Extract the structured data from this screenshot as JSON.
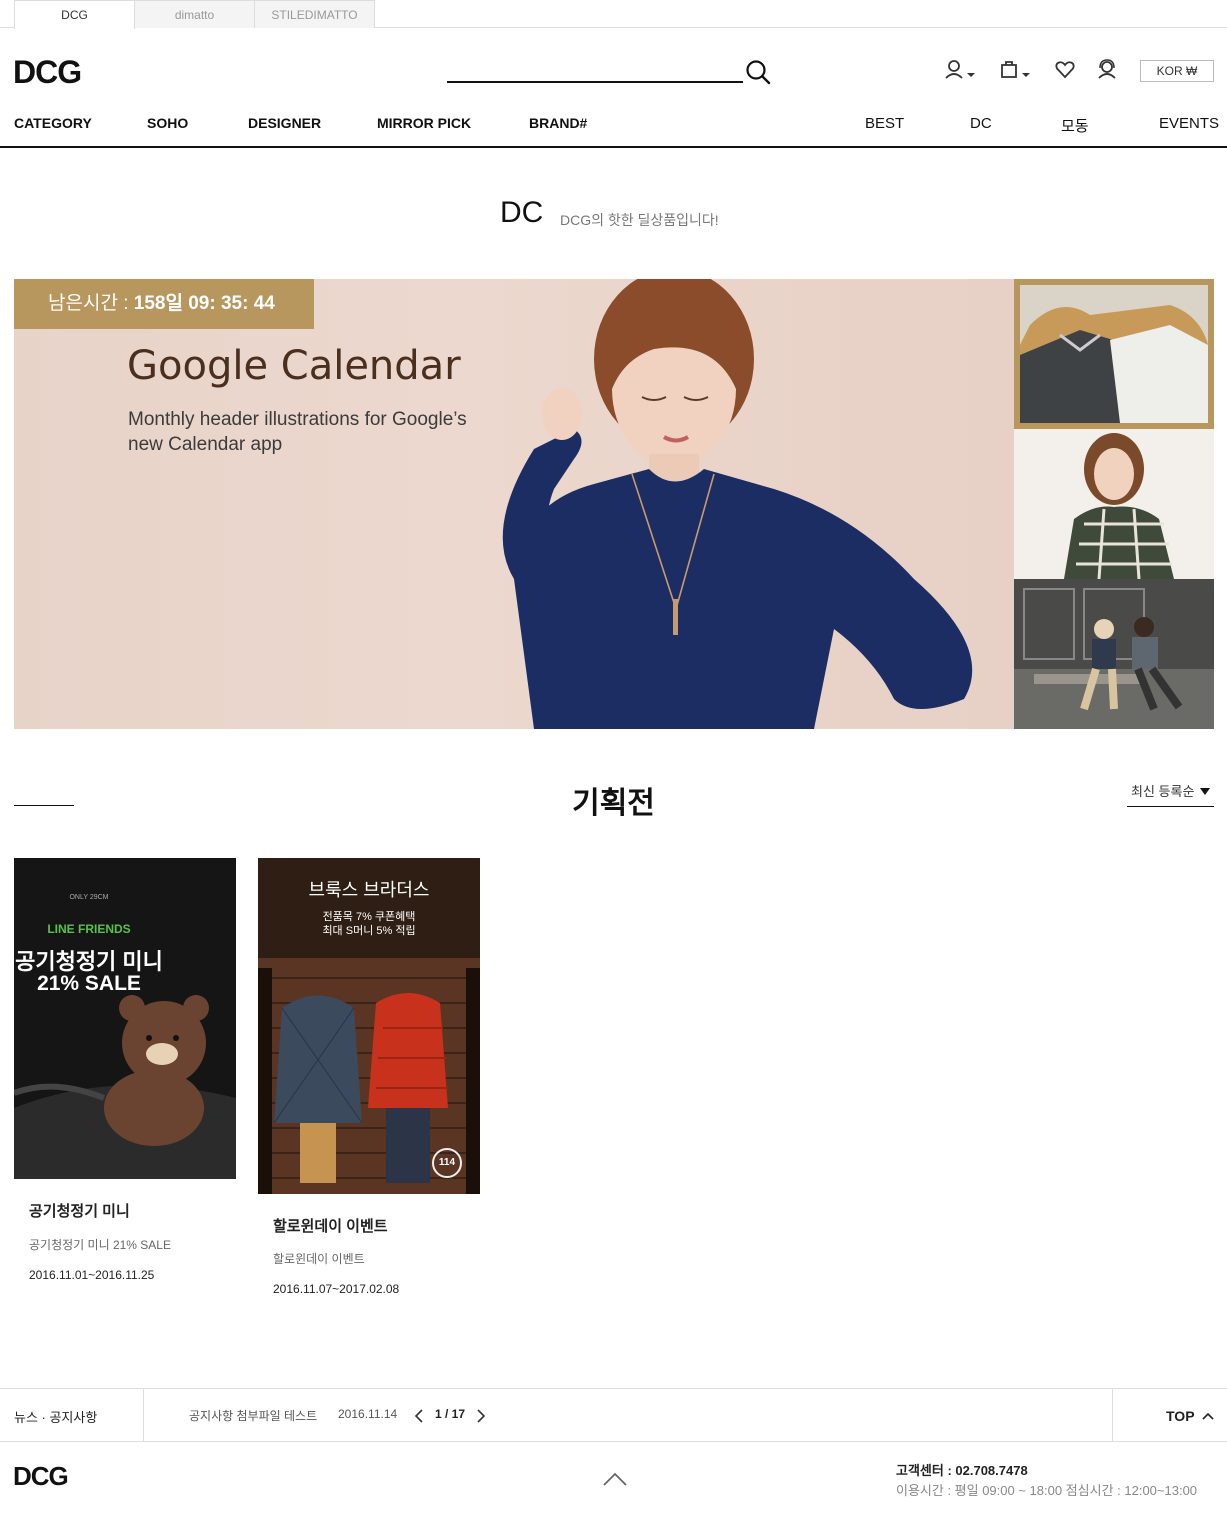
{
  "top_tabs": [
    "DCG",
    "dimatto",
    "STILEDIMATTO"
  ],
  "header": {
    "logo": "DCG",
    "search_placeholder": "",
    "currency": "KOR ₩",
    "icons": [
      "user-icon",
      "cart-icon",
      "heart-icon",
      "support-icon"
    ]
  },
  "nav": {
    "left": [
      "CATEGORY",
      "SOHO",
      "DESIGNER",
      "MIRROR PICK",
      "BRAND#"
    ],
    "right": [
      "BEST",
      "DC",
      "모동",
      "EVENTS"
    ]
  },
  "page": {
    "title": "DC",
    "subtitle": "DCG의 핫한 딜상품입니다!"
  },
  "banner": {
    "timer_label": "남은시간 :",
    "timer_value": "158일 09: 35: 44",
    "title": "Google Calendar",
    "description": "Monthly header illustrations for Google’s new Calendar app"
  },
  "section": {
    "title": "기획전",
    "sort_label": "최신 등록순"
  },
  "cards": [
    {
      "image_top": "ONLY 29CM",
      "image_brand": "LINE FRIENDS",
      "image_line1": "공기청정기 미니",
      "image_line2": "21% SALE",
      "title": "공기청정기 미니",
      "desc": "공기청정기 미니 21% SALE",
      "period": "2016.11.01~2016.11.25"
    },
    {
      "image_line1": "브룩스 브라더스",
      "image_line2": "전품목 7% 쿠폰혜택",
      "image_line3": "최대 S머니 5% 적립",
      "image_badge": "114",
      "title": "할로윈데이 이벤트",
      "desc": "할로윈데이 이벤트",
      "period": "2016.11.07~2017.02.08"
    }
  ],
  "notice": {
    "label": "뉴스 · 공지사항",
    "text": "공지사항 첨부파일 테스트",
    "date": "2016.11.14",
    "page": "1 / 17",
    "top_label": "TOP"
  },
  "footer": {
    "logo": "DCG",
    "cs": "고객센터 : 02.708.7478",
    "hours": "이용시간 : 평일 09:00 ~ 18:00 점심시간 : 12:00~13:00"
  }
}
